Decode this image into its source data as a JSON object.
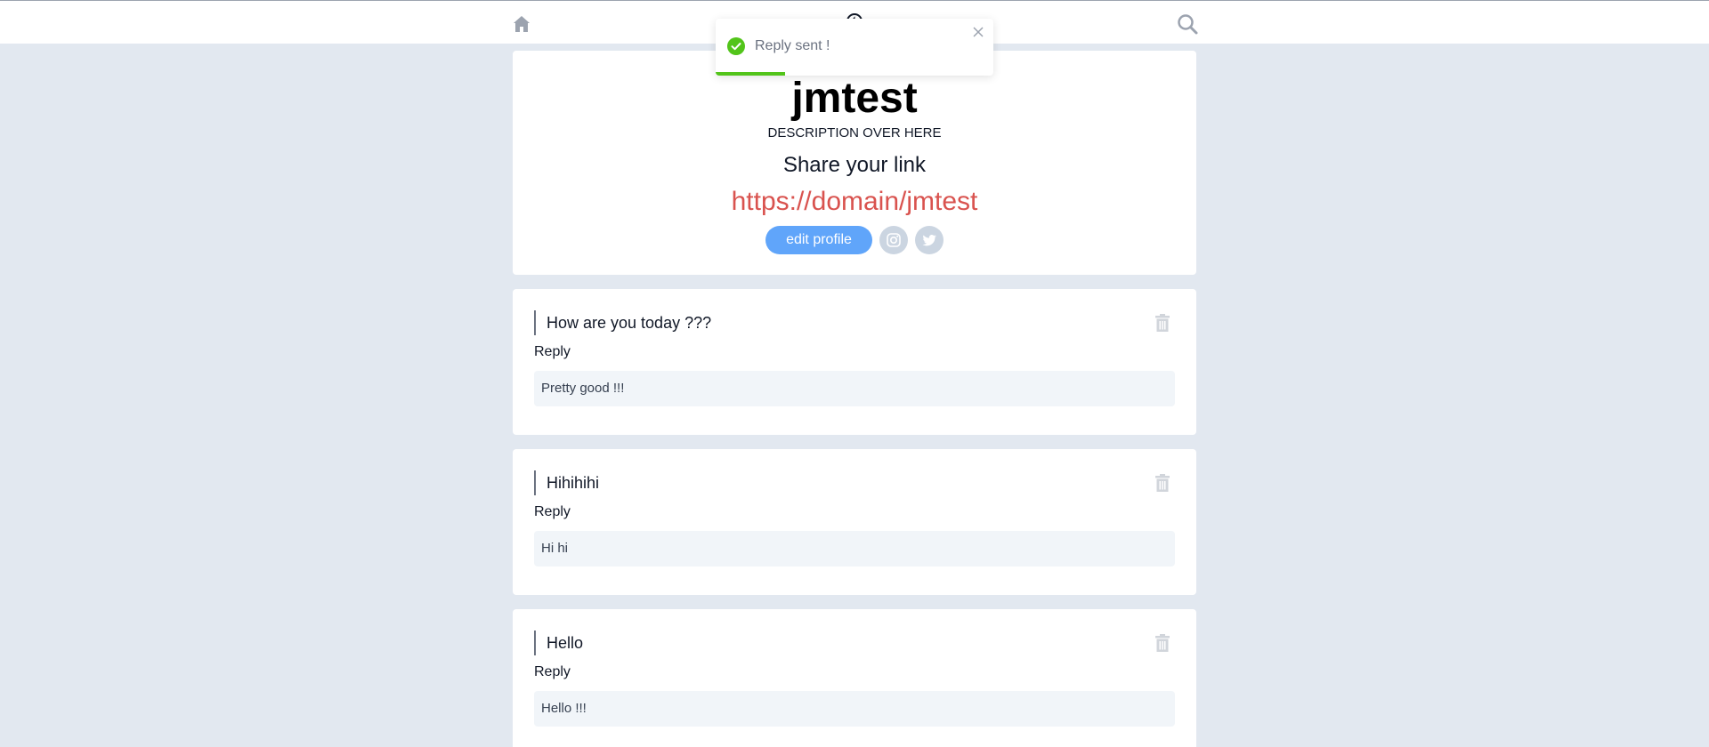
{
  "nav": {
    "home_icon": "home-icon",
    "logo_icon": "logo-icon",
    "search_icon": "search-icon"
  },
  "profile": {
    "name": "jmtest",
    "description": "DESCRIPTION OVER HERE",
    "share_title": "Share your link",
    "share_link": "https://domain/jmtest",
    "edit_label": "edit profile",
    "social": [
      {
        "icon": "instagram-icon"
      },
      {
        "icon": "twitter-icon"
      }
    ]
  },
  "messages": [
    {
      "question": "How are you today ???",
      "reply_label": "Reply",
      "reply": "Pretty good !!!",
      "delete_icon": "trash-icon"
    },
    {
      "question": "Hihihihi",
      "reply_label": "Reply",
      "reply": "Hi hi",
      "delete_icon": "trash-icon"
    },
    {
      "question": "Hello",
      "reply_label": "Reply",
      "reply": "Hello !!!",
      "delete_icon": "trash-icon"
    }
  ],
  "toast": {
    "message": "Reply sent !",
    "status_icon": "check-circle-icon",
    "close_icon": "close-icon",
    "progress": 0.25
  },
  "colors": {
    "background": "#e2e8f0",
    "accent": "#60a5fa",
    "link": "#d9534f",
    "success": "#52c41a"
  }
}
